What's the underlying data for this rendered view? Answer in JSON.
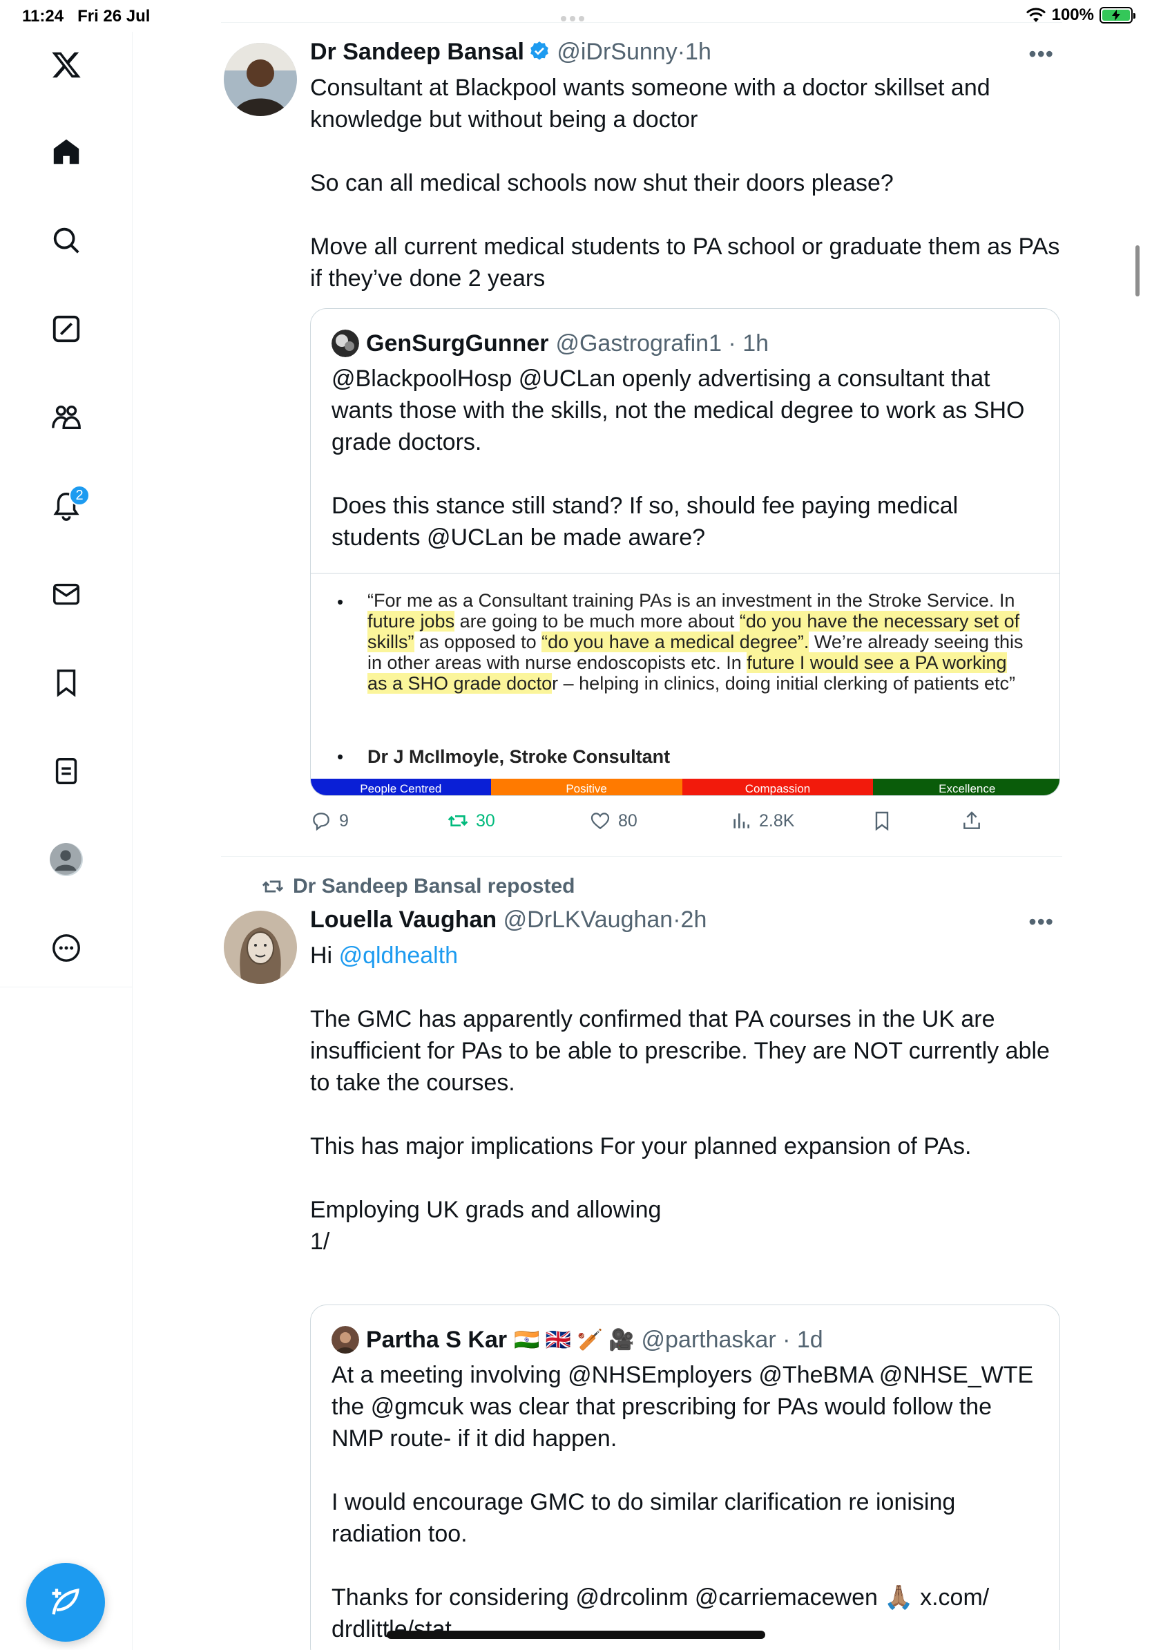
{
  "status_bar": {
    "time": "11:24",
    "date": "Fri 26 Jul",
    "battery": "100%"
  },
  "sidebar": {
    "items": [
      {
        "icon": "x-logo-icon"
      },
      {
        "icon": "home-icon"
      },
      {
        "icon": "search-icon"
      },
      {
        "icon": "grok-icon"
      },
      {
        "icon": "communities-icon"
      },
      {
        "icon": "notifications-icon",
        "badge": "2"
      },
      {
        "icon": "messages-icon"
      },
      {
        "icon": "bookmarks-icon"
      },
      {
        "icon": "lists-icon"
      },
      {
        "icon": "profile-avatar-icon"
      },
      {
        "icon": "more-icon"
      }
    ],
    "compose_icon": "compose-post-icon"
  },
  "tweets": [
    {
      "name": "Dr Sandeep Bansal",
      "handle": "@iDrSunny",
      "time": "1h",
      "verified": true,
      "body": [
        "Consultant at Blackpool wants someone with a doctor skillset and knowledge but without being a doctor",
        "",
        "So can all medical schools now shut their doors please?",
        "",
        "Move all current medical students to PA school or graduate them as PAs if they’ve done 2 years"
      ],
      "quote": {
        "name": "GenSurgGunner",
        "handle": "@Gastrografin1",
        "time": "1h",
        "body": [
          "@BlackpoolHosp @UCLan openly advertising a consultant that wants those with the skills, not the medical degree to work as SHO grade doctors.",
          "",
          "Does this stance still stand? If so, should fee paying medical students @UCLan be made aware?"
        ],
        "image": {
          "quote_parts": [
            {
              "t": "“For me as a Consultant training PAs is an investment in the Stroke Service.  In ",
              "h": false
            },
            {
              "t": "future jobs",
              "h": true
            },
            {
              "t": " are going to be much more about ",
              "h": false
            },
            {
              "t": "“do you have the necessary set of skills”",
              "h": true
            },
            {
              "t": " as opposed to ",
              "h": false
            },
            {
              "t": "“do you have a medical degree”.",
              "h": true
            },
            {
              "t": "  We’re already seeing this in other areas with nurse endoscopists etc.  In ",
              "h": false
            },
            {
              "t": "future I would see a PA working as a SHO grade docto",
              "h": true
            },
            {
              "t": "r – helping in clinics, doing initial clerking of patients etc”",
              "h": false
            }
          ],
          "signoff": "Dr J McIlmoyle, Stroke Consultant",
          "bar": [
            {
              "label": "People Centred",
              "color": "#0a1fd6"
            },
            {
              "label": "Positive",
              "color": "#ff7a00"
            },
            {
              "label": "Compassion",
              "color": "#f21a0c"
            },
            {
              "label": "Excellence",
              "color": "#0a5c0a"
            }
          ]
        }
      },
      "actions": {
        "replies": "9",
        "reposts": "30",
        "likes": "80",
        "views": "2.8K"
      }
    },
    {
      "repost_by": "Dr Sandeep Bansal reposted",
      "name": "Louella Vaughan",
      "handle": "@DrLKVaughan",
      "time": "2h",
      "body_greeting": "Hi ",
      "body_mention": "@qldhealth",
      "body": [
        "",
        "The GMC has apparently confirmed that PA courses in the  UK  are insufficient for PAs to be able to prescribe. They are NOT currently able to take the courses.",
        "",
        "This has major implications For your planned expansion of PAs.",
        "",
        "Employing UK grads and allowing",
        "1/"
      ],
      "quote": {
        "name": "Partha S Kar",
        "emojis": "🇮🇳 🇬🇧 🏏 🎥",
        "handle": "@parthaskar",
        "time": "1d",
        "body": [
          "At a meeting involving @NHSEmployers @TheBMA @NHSE_WTE the @gmcuk was clear that prescribing for PAs would follow the NMP route- if it did happen.",
          "",
          "I would encourage GMC to do similar clarification re ionising radiation too.",
          "",
          "Thanks for considering @drcolinm @carriemacewen 🙏🏽 x.com/ drdlittle/stat..."
        ]
      }
    }
  ]
}
